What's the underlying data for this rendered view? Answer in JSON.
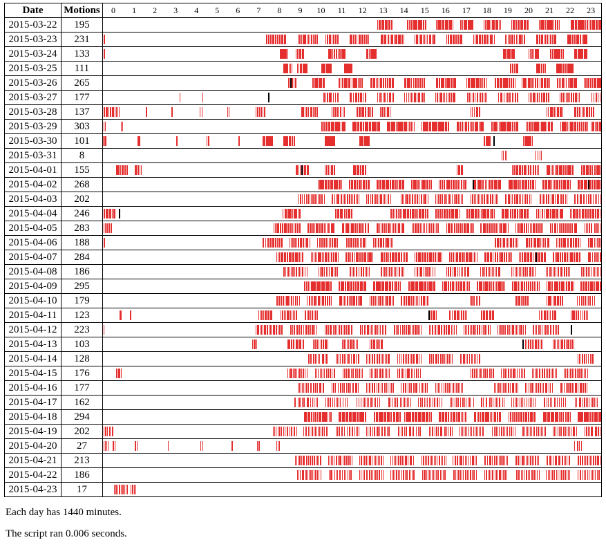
{
  "headers": {
    "date": "Date",
    "motions": "Motions",
    "hours": [
      "0",
      "1",
      "2",
      "3",
      "4",
      "5",
      "6",
      "7",
      "8",
      "9",
      "10",
      "11",
      "12",
      "13",
      "14",
      "15",
      "16",
      "17",
      "18",
      "19",
      "20",
      "21",
      "22",
      "23"
    ]
  },
  "rows": [
    {
      "date": "2015-03-22",
      "motions": 195,
      "segments": [
        [
          793,
          836
        ],
        [
          878,
          935
        ],
        [
          960,
          1010
        ],
        [
          1030,
          1070
        ],
        [
          1100,
          1150
        ],
        [
          1180,
          1230
        ],
        [
          1260,
          1320
        ],
        [
          1350,
          1439
        ]
      ]
    },
    {
      "date": "2015-03-23",
      "motions": 231,
      "segments": [
        [
          0,
          5
        ],
        [
          470,
          530
        ],
        [
          560,
          620
        ],
        [
          640,
          680
        ],
        [
          710,
          770
        ],
        [
          800,
          870
        ],
        [
          900,
          960
        ],
        [
          990,
          1040
        ],
        [
          1070,
          1130
        ],
        [
          1160,
          1220
        ],
        [
          1250,
          1310
        ],
        [
          1340,
          1400
        ]
      ]
    },
    {
      "date": "2015-03-24",
      "motions": 133,
      "segments": [
        [
          0,
          5
        ],
        [
          510,
          535
        ],
        [
          555,
          580
        ],
        [
          650,
          700
        ],
        [
          760,
          790
        ],
        [
          1155,
          1190
        ],
        [
          1230,
          1260
        ],
        [
          1290,
          1330
        ],
        [
          1360,
          1400
        ]
      ]
    },
    {
      "date": "2015-03-25",
      "motions": 111,
      "segments": [
        [
          520,
          545
        ],
        [
          560,
          590
        ],
        [
          630,
          660
        ],
        [
          695,
          720
        ],
        [
          1175,
          1200
        ],
        [
          1250,
          1280
        ],
        [
          1310,
          1360
        ]
      ]
    },
    {
      "date": "2015-03-26",
      "motions": 265,
      "segments": [
        [
          535,
          560
        ],
        [
          605,
          640
        ],
        [
          680,
          750
        ],
        [
          770,
          840
        ],
        [
          870,
          930
        ],
        [
          960,
          1020
        ],
        [
          1050,
          1110
        ],
        [
          1130,
          1190
        ],
        [
          1210,
          1290
        ],
        [
          1310,
          1370
        ],
        [
          1390,
          1439
        ]
      ],
      "black": [
        [
          540,
          544
        ]
      ]
    },
    {
      "date": "2015-03-27",
      "motions": 177,
      "segments": [
        [
          220,
          225
        ],
        [
          285,
          290
        ],
        [
          635,
          680
        ],
        [
          710,
          760
        ],
        [
          790,
          840
        ],
        [
          870,
          930
        ],
        [
          960,
          1020
        ],
        [
          1050,
          1110
        ],
        [
          1140,
          1200
        ],
        [
          1230,
          1290
        ],
        [
          1320,
          1380
        ],
        [
          1410,
          1439
        ]
      ],
      "black": [
        [
          476,
          480
        ]
      ]
    },
    {
      "date": "2015-03-28",
      "motions": 137,
      "segments": [
        [
          0,
          45
        ],
        [
          120,
          126
        ],
        [
          195,
          200
        ],
        [
          280,
          286
        ],
        [
          360,
          365
        ],
        [
          440,
          470
        ],
        [
          570,
          620
        ],
        [
          660,
          700
        ],
        [
          730,
          780
        ],
        [
          800,
          830
        ],
        [
          1060,
          1090
        ],
        [
          1280,
          1330
        ],
        [
          1360,
          1420
        ]
      ]
    },
    {
      "date": "2015-03-29",
      "motions": 303,
      "segments": [
        [
          0,
          8
        ],
        [
          50,
          56
        ],
        [
          630,
          700
        ],
        [
          720,
          800
        ],
        [
          820,
          900
        ],
        [
          920,
          1000
        ],
        [
          1020,
          1100
        ],
        [
          1120,
          1200
        ],
        [
          1220,
          1300
        ],
        [
          1320,
          1400
        ],
        [
          1410,
          1439
        ]
      ]
    },
    {
      "date": "2015-03-30",
      "motions": 101,
      "segments": [
        [
          0,
          10
        ],
        [
          100,
          108
        ],
        [
          210,
          216
        ],
        [
          300,
          306
        ],
        [
          390,
          395
        ],
        [
          460,
          490
        ],
        [
          520,
          555
        ],
        [
          640,
          670
        ],
        [
          740,
          770
        ],
        [
          1100,
          1120
        ],
        [
          1215,
          1240
        ]
      ],
      "black": [
        [
          1127,
          1130
        ]
      ]
    },
    {
      "date": "2015-03-31",
      "motions": 8,
      "segments": [
        [
          1150,
          1170
        ],
        [
          1245,
          1270
        ]
      ]
    },
    {
      "date": "2015-04-01",
      "motions": 155,
      "segments": [
        [
          35,
          70
        ],
        [
          90,
          110
        ],
        [
          555,
          595
        ],
        [
          640,
          670
        ],
        [
          720,
          760
        ],
        [
          1020,
          1040
        ],
        [
          1180,
          1260
        ],
        [
          1280,
          1360
        ],
        [
          1380,
          1439
        ]
      ],
      "black": [
        [
          572,
          575
        ]
      ]
    },
    {
      "date": "2015-04-02",
      "motions": 268,
      "segments": [
        [
          620,
          690
        ],
        [
          710,
          770
        ],
        [
          790,
          870
        ],
        [
          890,
          950
        ],
        [
          970,
          1050
        ],
        [
          1070,
          1150
        ],
        [
          1170,
          1250
        ],
        [
          1270,
          1350
        ],
        [
          1370,
          1439
        ]
      ],
      "black": [
        [
          1066,
          1070
        ],
        [
          1400,
          1404
        ]
      ]
    },
    {
      "date": "2015-04-03",
      "motions": 202,
      "segments": [
        [
          560,
          640
        ],
        [
          660,
          740
        ],
        [
          760,
          830
        ],
        [
          860,
          940
        ],
        [
          960,
          1040
        ],
        [
          1060,
          1140
        ],
        [
          1160,
          1240
        ],
        [
          1260,
          1340
        ],
        [
          1360,
          1439
        ]
      ]
    },
    {
      "date": "2015-04-04",
      "motions": 246,
      "segments": [
        [
          0,
          35
        ],
        [
          520,
          570
        ],
        [
          670,
          720
        ],
        [
          830,
          940
        ],
        [
          960,
          1030
        ],
        [
          1050,
          1130
        ],
        [
          1150,
          1230
        ],
        [
          1250,
          1330
        ],
        [
          1350,
          1439
        ]
      ],
      "black": [
        [
          45,
          48
        ]
      ]
    },
    {
      "date": "2015-04-05",
      "motions": 283,
      "segments": [
        [
          0,
          25
        ],
        [
          490,
          570
        ],
        [
          590,
          670
        ],
        [
          690,
          770
        ],
        [
          790,
          870
        ],
        [
          890,
          970
        ],
        [
          990,
          1070
        ],
        [
          1090,
          1170
        ],
        [
          1190,
          1270
        ],
        [
          1290,
          1370
        ],
        [
          1390,
          1439
        ]
      ]
    },
    {
      "date": "2015-04-06",
      "motions": 188,
      "segments": [
        [
          0,
          5
        ],
        [
          460,
          520
        ],
        [
          540,
          600
        ],
        [
          620,
          680
        ],
        [
          700,
          760
        ],
        [
          780,
          840
        ],
        [
          1130,
          1200
        ],
        [
          1220,
          1290
        ],
        [
          1310,
          1380
        ],
        [
          1400,
          1439
        ]
      ]
    },
    {
      "date": "2015-04-07",
      "motions": 284,
      "segments": [
        [
          500,
          580
        ],
        [
          600,
          680
        ],
        [
          700,
          780
        ],
        [
          800,
          880
        ],
        [
          900,
          980
        ],
        [
          1000,
          1080
        ],
        [
          1100,
          1180
        ],
        [
          1200,
          1280
        ],
        [
          1300,
          1380
        ],
        [
          1400,
          1439
        ]
      ],
      "black": [
        [
          1249,
          1253
        ]
      ]
    },
    {
      "date": "2015-04-08",
      "motions": 186,
      "segments": [
        [
          520,
          590
        ],
        [
          620,
          680
        ],
        [
          710,
          770
        ],
        [
          800,
          870
        ],
        [
          900,
          960
        ],
        [
          990,
          1060
        ],
        [
          1090,
          1150
        ],
        [
          1180,
          1250
        ],
        [
          1280,
          1350
        ],
        [
          1380,
          1439
        ]
      ]
    },
    {
      "date": "2015-04-09",
      "motions": 295,
      "segments": [
        [
          580,
          660
        ],
        [
          680,
          760
        ],
        [
          780,
          860
        ],
        [
          880,
          960
        ],
        [
          980,
          1060
        ],
        [
          1080,
          1160
        ],
        [
          1180,
          1260
        ],
        [
          1280,
          1360
        ],
        [
          1380,
          1439
        ]
      ]
    },
    {
      "date": "2015-04-10",
      "motions": 179,
      "segments": [
        [
          500,
          570
        ],
        [
          590,
          660
        ],
        [
          680,
          750
        ],
        [
          770,
          840
        ],
        [
          860,
          940
        ],
        [
          1060,
          1090
        ],
        [
          1190,
          1230
        ],
        [
          1280,
          1330
        ],
        [
          1370,
          1420
        ]
      ]
    },
    {
      "date": "2015-04-11",
      "motions": 123,
      "segments": [
        [
          45,
          55
        ],
        [
          75,
          82
        ],
        [
          450,
          490
        ],
        [
          510,
          560
        ],
        [
          580,
          620
        ],
        [
          940,
          965
        ],
        [
          1000,
          1050
        ],
        [
          1090,
          1130
        ],
        [
          1260,
          1310
        ],
        [
          1350,
          1400
        ]
      ],
      "black": [
        [
          940,
          943
        ]
      ]
    },
    {
      "date": "2015-04-12",
      "motions": 223,
      "segments": [
        [
          0,
          5
        ],
        [
          440,
          520
        ],
        [
          540,
          620
        ],
        [
          640,
          720
        ],
        [
          740,
          820
        ],
        [
          840,
          920
        ],
        [
          940,
          1020
        ],
        [
          1040,
          1120
        ],
        [
          1140,
          1220
        ],
        [
          1240,
          1320
        ]
      ],
      "black": [
        [
          1350,
          1354
        ]
      ]
    },
    {
      "date": "2015-04-13",
      "motions": 103,
      "segments": [
        [
          430,
          445
        ],
        [
          530,
          580
        ],
        [
          605,
          650
        ],
        [
          690,
          735
        ],
        [
          770,
          810
        ],
        [
          1220,
          1270
        ],
        [
          1300,
          1360
        ]
      ],
      "black": [
        [
          1211,
          1214
        ]
      ]
    },
    {
      "date": "2015-04-14",
      "motions": 128,
      "segments": [
        [
          590,
          650
        ],
        [
          670,
          740
        ],
        [
          760,
          830
        ],
        [
          850,
          920
        ],
        [
          940,
          1010
        ],
        [
          1030,
          1090
        ],
        [
          1370,
          1420
        ]
      ]
    },
    {
      "date": "2015-04-15",
      "motions": 176,
      "segments": [
        [
          35,
          55
        ],
        [
          530,
          590
        ],
        [
          610,
          670
        ],
        [
          690,
          750
        ],
        [
          770,
          830
        ],
        [
          850,
          920
        ],
        [
          1060,
          1130
        ],
        [
          1150,
          1220
        ],
        [
          1240,
          1310
        ],
        [
          1330,
          1400
        ]
      ]
    },
    {
      "date": "2015-04-16",
      "motions": 177,
      "segments": [
        [
          560,
          640
        ],
        [
          660,
          740
        ],
        [
          760,
          840
        ],
        [
          860,
          940
        ],
        [
          960,
          1040
        ],
        [
          1130,
          1200
        ],
        [
          1220,
          1300
        ],
        [
          1320,
          1400
        ]
      ]
    },
    {
      "date": "2015-04-17",
      "motions": 162,
      "segments": [
        [
          550,
          620
        ],
        [
          640,
          710
        ],
        [
          730,
          800
        ],
        [
          820,
          890
        ],
        [
          910,
          980
        ],
        [
          1000,
          1070
        ],
        [
          1090,
          1160
        ],
        [
          1180,
          1250
        ],
        [
          1270,
          1340
        ],
        [
          1360,
          1430
        ]
      ]
    },
    {
      "date": "2015-04-18",
      "motions": 294,
      "segments": [
        [
          580,
          660
        ],
        [
          680,
          760
        ],
        [
          780,
          860
        ],
        [
          870,
          950
        ],
        [
          970,
          1050
        ],
        [
          1070,
          1150
        ],
        [
          1170,
          1250
        ],
        [
          1270,
          1350
        ],
        [
          1370,
          1439
        ]
      ]
    },
    {
      "date": "2015-04-19",
      "motions": 202,
      "segments": [
        [
          0,
          30
        ],
        [
          490,
          560
        ],
        [
          580,
          650
        ],
        [
          670,
          740
        ],
        [
          760,
          830
        ],
        [
          850,
          920
        ],
        [
          940,
          1010
        ],
        [
          1030,
          1100
        ],
        [
          1120,
          1190
        ],
        [
          1210,
          1280
        ],
        [
          1300,
          1370
        ],
        [
          1390,
          1439
        ]
      ]
    },
    {
      "date": "2015-04-20",
      "motions": 27,
      "segments": [
        [
          0,
          15
        ],
        [
          25,
          38
        ],
        [
          90,
          100
        ],
        [
          185,
          192
        ],
        [
          280,
          287
        ],
        [
          370,
          377
        ],
        [
          445,
          455
        ],
        [
          500,
          510
        ],
        [
          1360,
          1385
        ]
      ]
    },
    {
      "date": "2015-04-21",
      "motions": 213,
      "segments": [
        [
          555,
          630
        ],
        [
          650,
          720
        ],
        [
          740,
          810
        ],
        [
          830,
          900
        ],
        [
          920,
          990
        ],
        [
          1010,
          1080
        ],
        [
          1100,
          1170
        ],
        [
          1190,
          1260
        ],
        [
          1280,
          1350
        ],
        [
          1370,
          1439
        ]
      ]
    },
    {
      "date": "2015-04-22",
      "motions": 186,
      "segments": [
        [
          560,
          630
        ],
        [
          650,
          720
        ],
        [
          740,
          810
        ],
        [
          830,
          900
        ],
        [
          920,
          990
        ],
        [
          1010,
          1080
        ],
        [
          1100,
          1170
        ],
        [
          1190,
          1260
        ],
        [
          1280,
          1350
        ],
        [
          1370,
          1439
        ]
      ]
    },
    {
      "date": "2015-04-23",
      "motions": 17,
      "segments": [
        [
          30,
          70
        ],
        [
          78,
          95
        ]
      ]
    }
  ],
  "notes": {
    "minutes": "Each day has 1440 minutes.",
    "runtime": "The script ran 0.006 seconds."
  }
}
